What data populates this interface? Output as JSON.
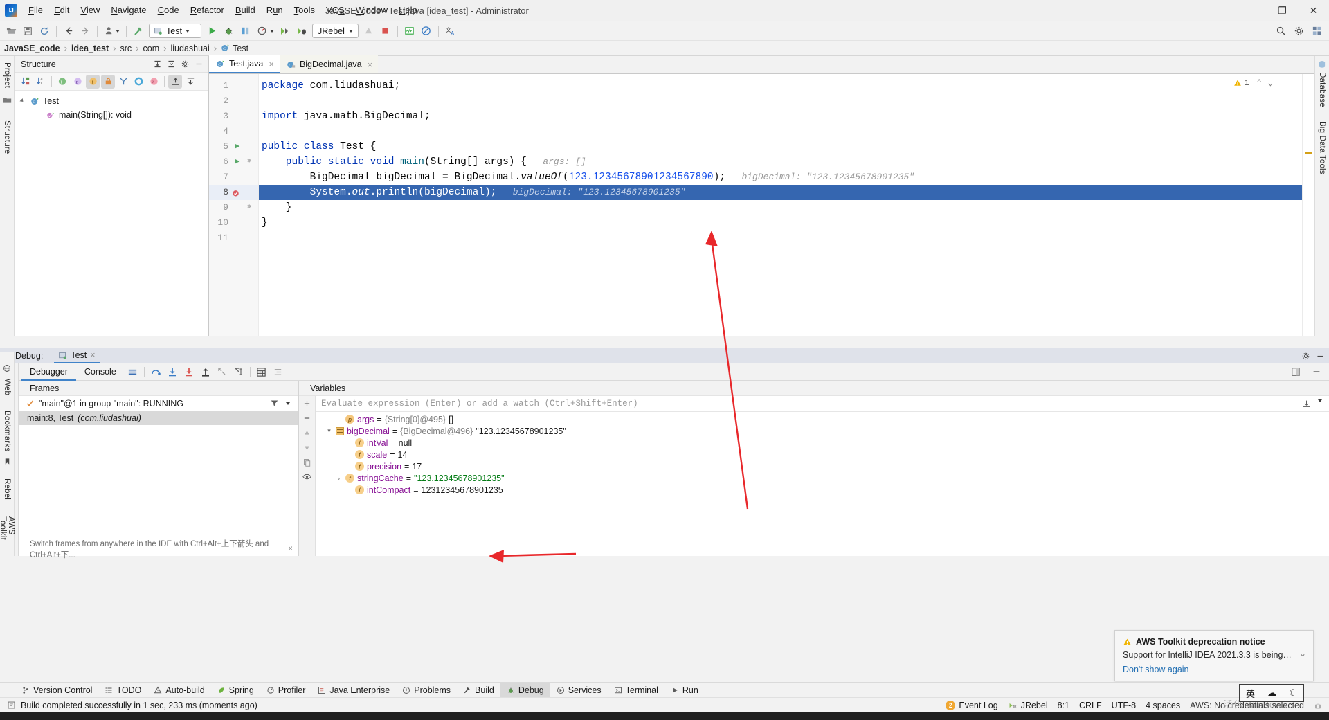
{
  "window": {
    "title": "JavaSE_code - Test.java [idea_test] - Administrator",
    "minimize": "–",
    "maximize": "❐",
    "close": "✕"
  },
  "menu": [
    {
      "label": "File"
    },
    {
      "label": "Edit"
    },
    {
      "label": "View"
    },
    {
      "label": "Navigate"
    },
    {
      "label": "Code"
    },
    {
      "label": "Refactor"
    },
    {
      "label": "Build"
    },
    {
      "label": "Run"
    },
    {
      "label": "Tools"
    },
    {
      "label": "VCS"
    },
    {
      "label": "Window"
    },
    {
      "label": "Help"
    }
  ],
  "toolbar": {
    "run_config": "Test",
    "jrebel": "JRebel",
    "icons": [
      "open-folder-icon",
      "save-icon",
      "sync-icon",
      "back-arrow-icon",
      "forward-arrow-icon",
      "user-profile-icon",
      "build-hammer-icon",
      "run-icon",
      "debug-icon",
      "run-coverage-icon",
      "profile-icon",
      "jrebel-run-icon",
      "jrebel-debug-icon",
      "update-app-icon",
      "stop-icon",
      "monitor-icon",
      "no-entry-icon",
      "translate-icon",
      "search-everywhere-icon",
      "settings-gear-icon",
      "project-structure-icon"
    ]
  },
  "breadcrumb": [
    {
      "label": "JavaSE_code",
      "bold": true
    },
    {
      "label": "idea_test",
      "bold": true
    },
    {
      "label": "src",
      "bold": false
    },
    {
      "label": "com",
      "bold": false
    },
    {
      "label": "liudashuai",
      "bold": false
    },
    {
      "label": "Test",
      "bold": false,
      "icon": "java-class-icon"
    }
  ],
  "left_strip": {
    "project": "Project",
    "structure": "Structure",
    "web": "Web",
    "bookmarks": "Bookmarks",
    "rebel": "Rebel",
    "aws": "AWS Toolkit"
  },
  "right_strip": {
    "database": "Database",
    "bigdata": "Big Data Tools"
  },
  "structure": {
    "title": "Structure",
    "toolbar_icons": [
      "sort-by-visibility-icon",
      "sort-alphabetically-icon",
      "show-inherited-icon",
      "show-properties-icon",
      "show-fields-icon",
      "show-non-public-icon",
      "group-methods-icon",
      "show-interfaces-icon",
      "show-lambdas-icon",
      "expand-all-icon",
      "collapse-all-icon"
    ],
    "header_icons": [
      "expand-all-icon",
      "collapse-all-icon",
      "settings-gear-icon",
      "hide-icon"
    ],
    "tree": [
      {
        "label": "Test",
        "icon": "java-class-icon",
        "level": 0,
        "expanded": true
      },
      {
        "label": "main(String[]): void",
        "icon": "method-icon",
        "level": 1,
        "expanded": false
      }
    ]
  },
  "editor": {
    "tabs": [
      {
        "label": "Test.java",
        "active": true,
        "icon": "java-runnable-class-icon"
      },
      {
        "label": "BigDecimal.java",
        "active": false,
        "icon": "java-readonly-class-icon"
      }
    ],
    "warning_count": "1",
    "lines": [
      {
        "n": "1",
        "run": false,
        "fold": "",
        "active": false
      },
      {
        "n": "2",
        "run": false,
        "fold": "",
        "active": false
      },
      {
        "n": "3",
        "run": false,
        "fold": "",
        "active": false
      },
      {
        "n": "4",
        "run": false,
        "fold": "",
        "active": false
      },
      {
        "n": "5",
        "run": true,
        "fold": "",
        "active": false
      },
      {
        "n": "6",
        "run": true,
        "fold": "⊖",
        "active": false
      },
      {
        "n": "7",
        "run": false,
        "fold": "",
        "active": false
      },
      {
        "n": "8",
        "run": false,
        "fold": "",
        "active": true,
        "breakpoint": true
      },
      {
        "n": "9",
        "run": false,
        "fold": "⊕",
        "active": false
      },
      {
        "n": "10",
        "run": false,
        "fold": "",
        "active": false
      },
      {
        "n": "11",
        "run": false,
        "fold": "",
        "active": false
      }
    ],
    "code": {
      "l1_kw": "package",
      "l1_rest": " com.liudashuai;",
      "l3_kw": "import",
      "l3_rest": " java.math.BigDecimal;",
      "l5_a": "public class",
      "l5_b": " Test {",
      "l6_a": "    public static void ",
      "l6_b": "main",
      "l6_c": "(String[] args) {",
      "l6_hint": "args: []",
      "l7_a": "        BigDecimal bigDecimal = BigDecimal.",
      "l7_b": "valueOf",
      "l7_c": "(",
      "l7_num": "123.12345678901234567890",
      "l7_d": ");",
      "l7_hint": "bigDecimal: \"123.12345678901235\"",
      "l8_a": "        System.",
      "l8_b": "out",
      "l8_c": ".println(bigDecimal);",
      "l8_hint": "bigDecimal: \"123.12345678901235\"",
      "l9": "    }",
      "l10": "}"
    }
  },
  "debug": {
    "label": "Debug:",
    "run_tab": "Test",
    "tabs": [
      {
        "label": "Debugger",
        "active": true
      },
      {
        "label": "Console",
        "active": false
      }
    ],
    "tool_icons": [
      "layout-settings-icon",
      "step-over-icon",
      "step-into-icon",
      "force-step-into-icon",
      "step-out-icon",
      "drop-frame-icon",
      "run-to-cursor-icon",
      "evaluate-expression-icon",
      "mute-breakpoints-icon"
    ],
    "left_tool_icons": [
      "rerun-icon",
      "settings-wrench-icon",
      "resume-icon",
      "pause-icon",
      "stop-icon",
      "view-breakpoints-icon",
      "mute-breakpoints-icon",
      "camera-icon",
      "settings-icon",
      "pin-icon"
    ],
    "header_icons": [
      "settings-gear-icon",
      "hide-icon"
    ],
    "frames": {
      "title": "Frames",
      "thread": "\"main\"@1 in group \"main\": RUNNING",
      "rows": [
        {
          "label": "main:8, Test",
          "italic": "(com.liudashuai)",
          "selected": true
        }
      ],
      "footer": "Switch frames from anywhere in the IDE with Ctrl+Alt+上下箭头 and Ctrl+Alt+下...",
      "filter_icon": "filter-icon"
    },
    "variables": {
      "title": "Variables",
      "eval_placeholder": "Evaluate expression (Enter) or add a watch (Ctrl+Shift+Enter)",
      "rows": [
        {
          "indent": 1,
          "chev": "",
          "icon": "p",
          "name": "args",
          "eq": " = ",
          "ref": "{String[0]@495}",
          "value": "[]",
          "value_type": "plain"
        },
        {
          "indent": 0,
          "chev": "▾",
          "icon": "obj",
          "name": "bigDecimal",
          "eq": " = ",
          "ref": "{BigDecimal@496}",
          "value": "\"123.12345678901235\"",
          "value_type": "plain"
        },
        {
          "indent": 2,
          "chev": "",
          "icon": "f",
          "name": "intVal",
          "eq": " = ",
          "ref": "",
          "value": "null",
          "value_type": "plain"
        },
        {
          "indent": 2,
          "chev": "",
          "icon": "f",
          "name": "scale",
          "eq": " = ",
          "ref": "",
          "value": "14",
          "value_type": "plain"
        },
        {
          "indent": 2,
          "chev": "",
          "icon": "f",
          "name": "precision",
          "eq": " = ",
          "ref": "",
          "value": "17",
          "value_type": "plain"
        },
        {
          "indent": 1,
          "chev": "›",
          "icon": "f",
          "name": "stringCache",
          "eq": " = ",
          "ref": "",
          "value": "\"123.12345678901235\"",
          "value_type": "string"
        },
        {
          "indent": 2,
          "chev": "",
          "icon": "f",
          "name": "intCompact",
          "eq": " = ",
          "ref": "",
          "value": "12312345678901235",
          "value_type": "plain"
        }
      ]
    }
  },
  "notification": {
    "title": "AWS Toolkit deprecation notice",
    "body": "Support for IntelliJ IDEA 2021.3.3 is being…",
    "link": "Don't show again",
    "warn_icon": "warning-triangle-icon",
    "collapse_icon": "chevron-down-icon"
  },
  "toolwindow_bar": [
    {
      "label": "Version Control",
      "icon": "branch-icon",
      "active": false
    },
    {
      "label": "TODO",
      "icon": "todo-icon",
      "active": false
    },
    {
      "label": "Auto-build",
      "icon": "warning-icon",
      "active": false
    },
    {
      "label": "Spring",
      "icon": "spring-leaf-icon",
      "active": false
    },
    {
      "label": "Profiler",
      "icon": "profiler-icon",
      "active": false
    },
    {
      "label": "Java Enterprise",
      "icon": "java-ee-icon",
      "active": false
    },
    {
      "label": "Problems",
      "icon": "problems-icon",
      "active": false
    },
    {
      "label": "Build",
      "icon": "build-hammer-icon",
      "active": false
    },
    {
      "label": "Debug",
      "icon": "debug-bug-icon",
      "active": true
    },
    {
      "label": "Services",
      "icon": "services-icon",
      "active": false
    },
    {
      "label": "Terminal",
      "icon": "terminal-icon",
      "active": false
    },
    {
      "label": "Run",
      "icon": "run-triangle-icon",
      "active": false
    }
  ],
  "statusbar": {
    "message": "Build completed successfully in 1 sec, 233 ms (moments ago)",
    "message_icon": "console-icon",
    "event_log": "Event Log",
    "event_log_count": "2",
    "jrebel": "JRebel",
    "position": "8:1",
    "line_sep": "CRLF",
    "encoding": "UTF-8",
    "indent": "4 spaces",
    "aws": "AWS: No credentials selected",
    "ime": [
      "英",
      "☁",
      "☾"
    ],
    "watermark": "活化 Windows"
  },
  "colors": {
    "accent": "#4083c9",
    "selection": "#3566b0",
    "keyword": "#0033b3",
    "number": "#1750eb",
    "string": "#067d17",
    "arrow_red": "#e8282b",
    "green_run": "#59a869"
  }
}
